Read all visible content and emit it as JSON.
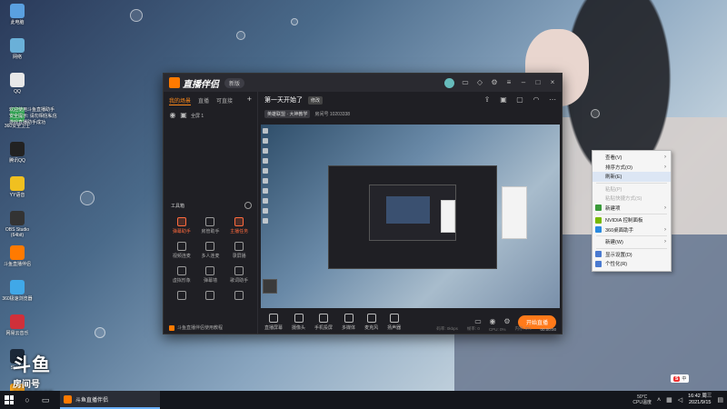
{
  "desktop": {
    "icons": [
      {
        "label": "此电脑",
        "color": "#5aa0e0"
      },
      {
        "label": "网络",
        "color": "#6ab0d8"
      },
      {
        "label": "QQ",
        "color": "#e8e8e8"
      },
      {
        "label": "360安全卫士",
        "color": "#3ab860"
      },
      {
        "label": "腾讯QQ",
        "color": "#222222"
      },
      {
        "label": "YY语音",
        "color": "#f0c020"
      },
      {
        "label": "OBS Studio (64bit)",
        "color": "#333333"
      },
      {
        "label": "斗鱼直播伴侣",
        "color": "#ff7a00"
      },
      {
        "label": "360极速浏览器",
        "color": "#40a8e8"
      },
      {
        "label": "网易云音乐",
        "color": "#d0303a"
      },
      {
        "label": "Steam",
        "color": "#1b2838"
      },
      {
        "label": "WeGame",
        "color": "#ffaa22"
      }
    ],
    "notice_lines": [
      "欢迎使用斗鱼直播助手",
      "安全提示: 请勿相信私信",
      "游戏直播助手成功"
    ],
    "logo_text": "斗鱼",
    "room_label": "房间号",
    "room_number": "10203338"
  },
  "app": {
    "title": "直播伴侣",
    "version": "新版",
    "left_tabs": [
      "我的场景",
      "直播",
      "可直接"
    ],
    "add_label": "+",
    "scene_label": "全屏 1",
    "tools_title": "工具箱",
    "tools": [
      {
        "label": "弹幕助手",
        "hot": true
      },
      {
        "label": "房管助手",
        "hot": false
      },
      {
        "label": "主播任务",
        "hot": true
      },
      {
        "label": "视频连麦",
        "hot": false
      },
      {
        "label": "多人连麦",
        "hot": false
      },
      {
        "label": "录屏播",
        "hot": false
      },
      {
        "label": "虚拟形象",
        "hot": false
      },
      {
        "label": "弹幕墙",
        "hot": false
      },
      {
        "label": "歌词助手",
        "hot": false
      },
      {
        "label": "",
        "hot": false
      },
      {
        "label": "",
        "hot": false
      },
      {
        "label": "",
        "hot": false
      }
    ],
    "footer": "斗鱼直播伴侣使用教程",
    "stream_title": "第一天开始了",
    "edit_label": "修改",
    "category": "英雄联盟 · 大神教学",
    "room_info": "房间号 10203338",
    "controls": [
      "直播屏幕",
      "摄像头",
      "手机投屏",
      "多媒体",
      "麦克风",
      "扬声器"
    ],
    "start_label": "开始直播",
    "status": [
      "码率: 0kbps",
      "帧率: 0",
      "CPU: 0%",
      "内存: 0%"
    ],
    "status_time": "00:00:00"
  },
  "context_menu": {
    "items": [
      {
        "label": "查看(V)",
        "arrow": true,
        "disabled": false,
        "hover": false,
        "icon": ""
      },
      {
        "label": "排序方式(O)",
        "arrow": true,
        "disabled": false,
        "hover": false,
        "icon": ""
      },
      {
        "label": "刷新(E)",
        "arrow": false,
        "disabled": false,
        "hover": true,
        "icon": ""
      },
      {
        "sep": true
      },
      {
        "label": "粘贴(P)",
        "arrow": false,
        "disabled": true,
        "hover": false,
        "icon": ""
      },
      {
        "label": "粘贴快捷方式(S)",
        "arrow": false,
        "disabled": true,
        "hover": false,
        "icon": ""
      },
      {
        "label": "新建项",
        "arrow": true,
        "disabled": false,
        "hover": false,
        "icon": "#3a9a3a"
      },
      {
        "sep": true
      },
      {
        "label": "NVIDIA 控制面板",
        "arrow": false,
        "disabled": false,
        "hover": false,
        "icon": "#76b900"
      },
      {
        "label": "360桌面助手",
        "arrow": true,
        "disabled": false,
        "hover": false,
        "icon": "#2a8ae0"
      },
      {
        "sep": true
      },
      {
        "label": "新建(W)",
        "arrow": true,
        "disabled": false,
        "hover": false,
        "icon": ""
      },
      {
        "sep": true
      },
      {
        "label": "显示设置(D)",
        "arrow": false,
        "disabled": false,
        "hover": false,
        "icon": "#4a7ad0"
      },
      {
        "label": "个性化(R)",
        "arrow": false,
        "disabled": false,
        "hover": false,
        "icon": "#4a7ad0"
      }
    ]
  },
  "taskbar": {
    "app_label": "斗鱼直播伴侣",
    "temp": "50°C",
    "cpu_label": "CPU温度",
    "time": "16:42 周三",
    "date": "2021/9/15",
    "ime_label": "中"
  }
}
